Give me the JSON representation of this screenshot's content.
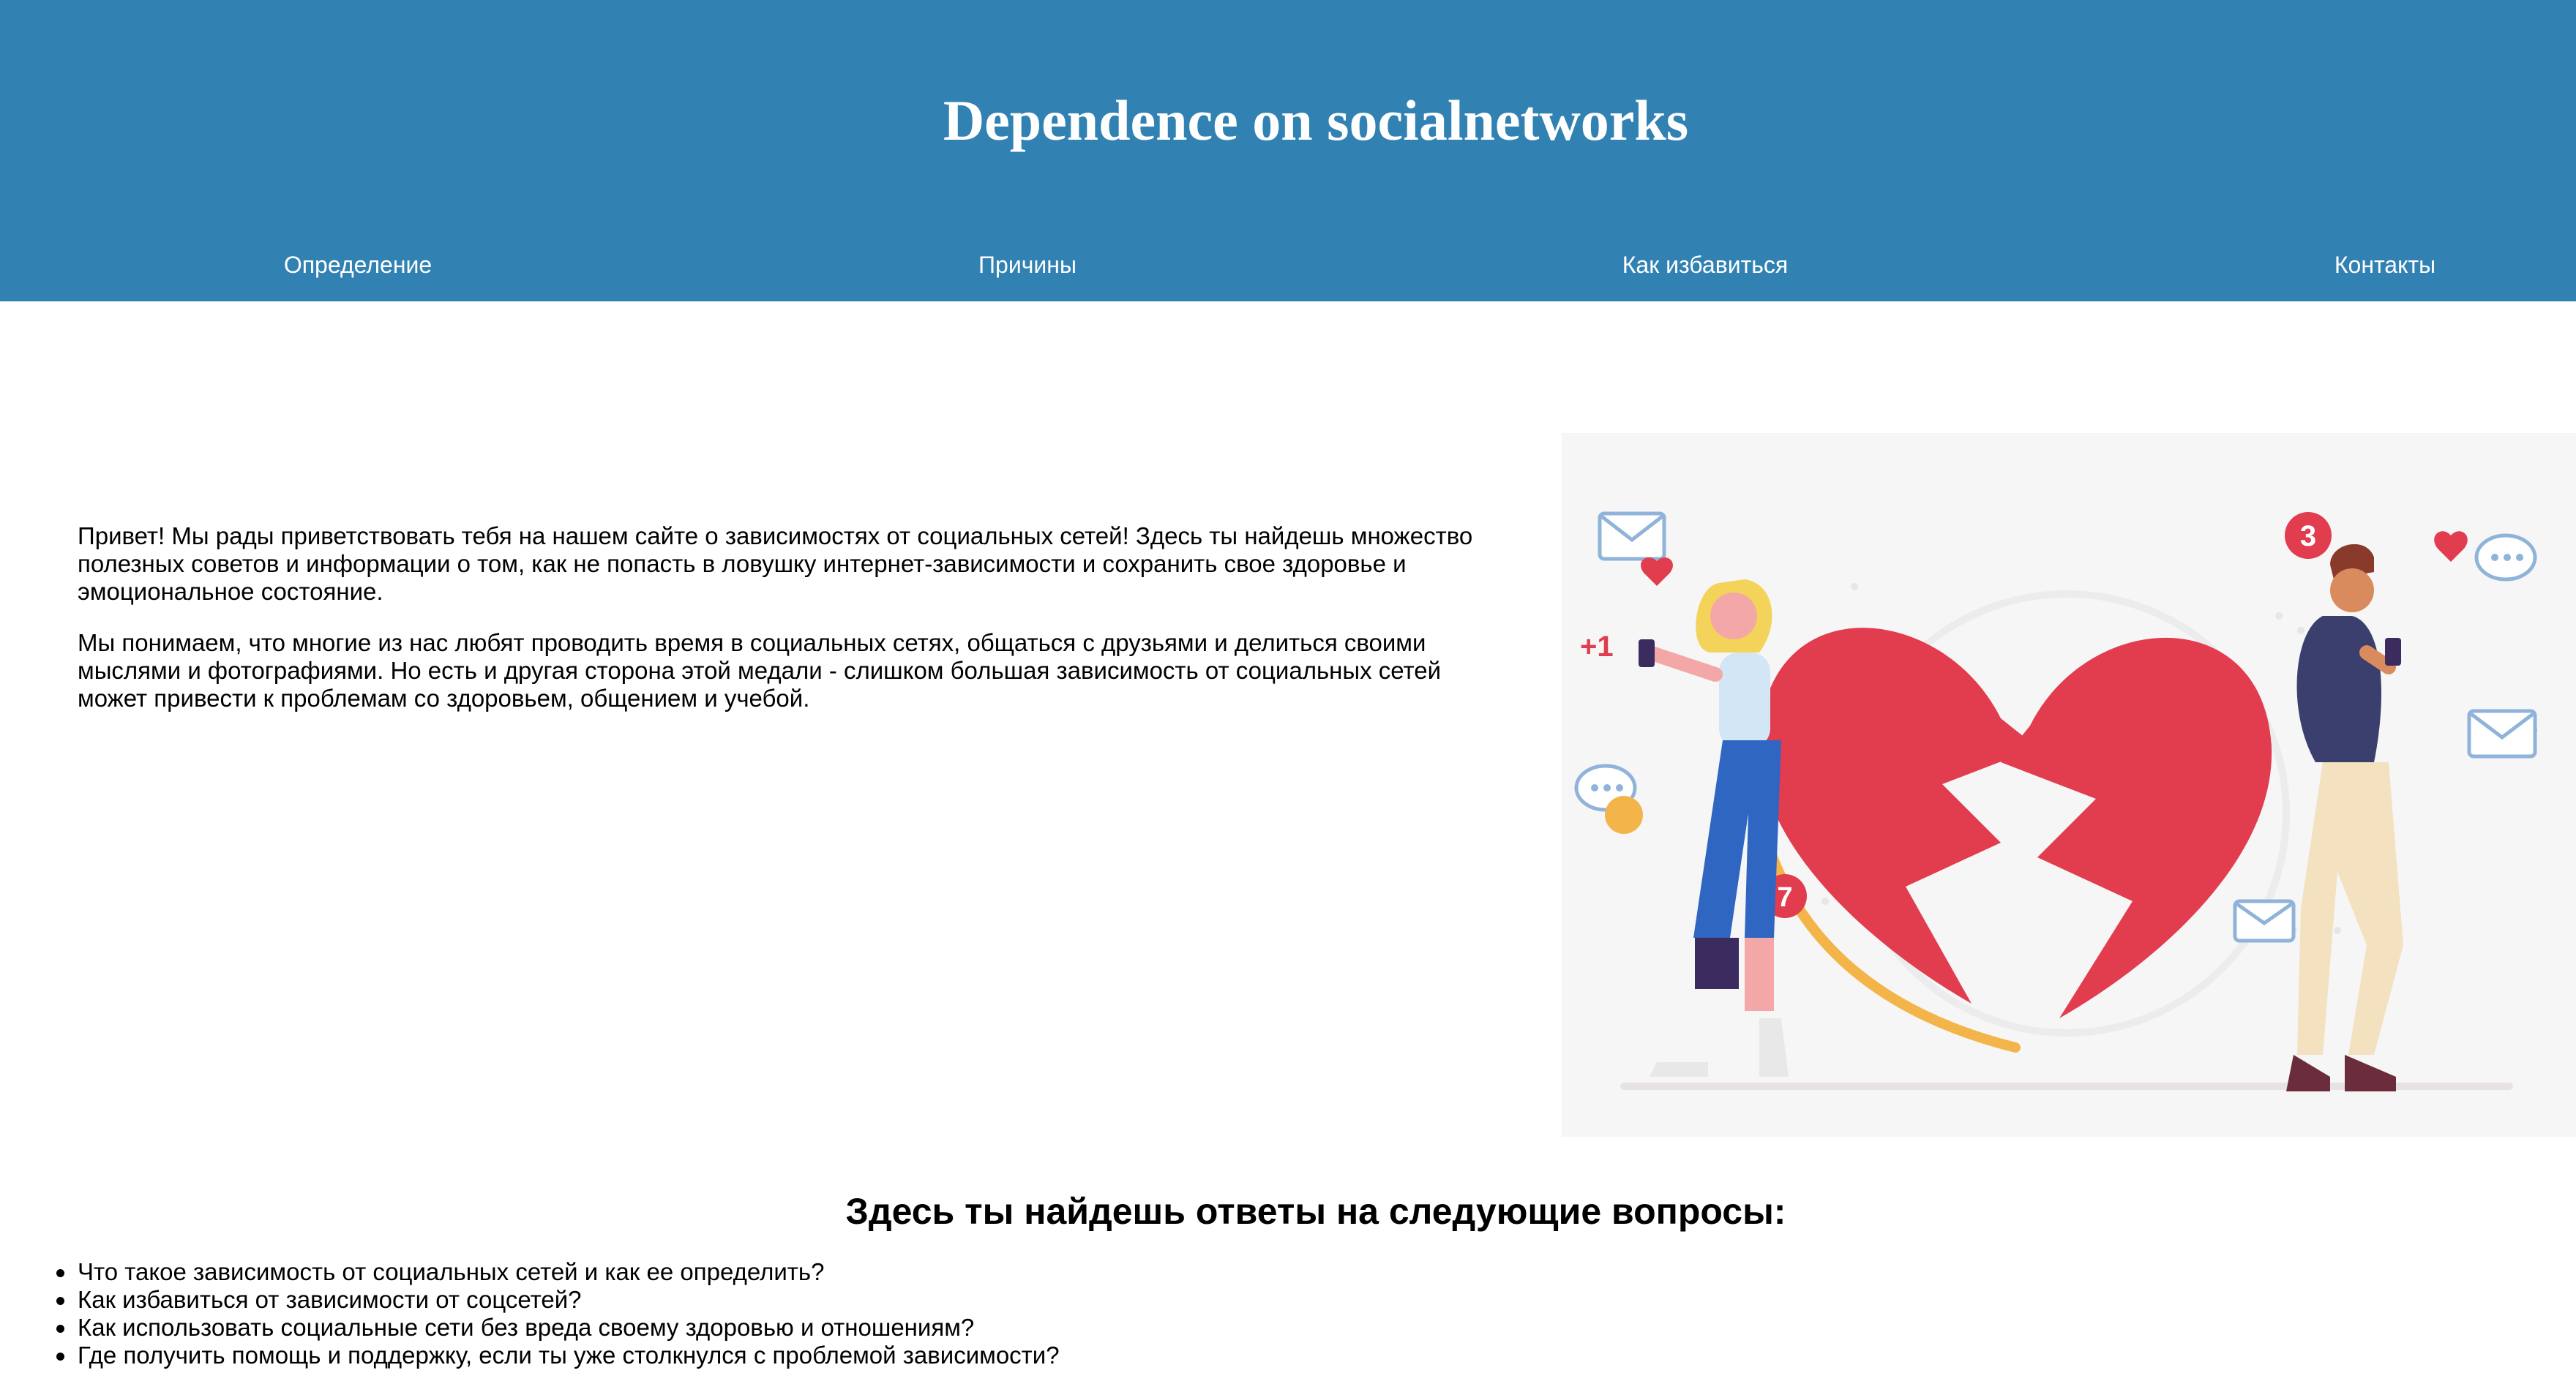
{
  "header": {
    "title": "Dependence on socialnetworks",
    "bg_color": "#3182b3"
  },
  "nav": {
    "items": [
      {
        "label": "Определение"
      },
      {
        "label": "Причины"
      },
      {
        "label": "Как избавиться"
      },
      {
        "label": "Контакты"
      }
    ]
  },
  "intro": {
    "paragraphs": [
      "Привет! Мы рады приветствовать тебя на нашем сайте о зависимостях от социальных сетей! Здесь ты найдешь множество полезных советов и информации о том, как не попасть в ловушку интернет-зависимости и сохранить свое здоровье и эмоциональное состояние.",
      "Мы понимаем, что многие из нас любят проводить время в социальных сетях, общаться с друзьями и делиться своими мыслями и фотографиями. Но есть и другая сторона этой медали - слишком большая зависимость от социальных сетей может привести к проблемам со здоровьем, общением и учебой."
    ]
  },
  "illustration": {
    "icon": "broken-heart-couple-illustration",
    "badges": [
      "3",
      "7",
      "+1"
    ],
    "heart_color": "#e23c4f"
  },
  "questions": {
    "title": "Здесь ты найдешь ответы на следующие вопросы:",
    "items": [
      "Что такое зависимость от социальных сетей и как ее определить?",
      "Как избавиться от зависимости от соцсетей?",
      "Как использовать социальные сети без вреда своему здоровью и отношениям?",
      "Где получить помощь и поддержку, если ты уже столкнулся с проблемой зависимости?"
    ]
  }
}
